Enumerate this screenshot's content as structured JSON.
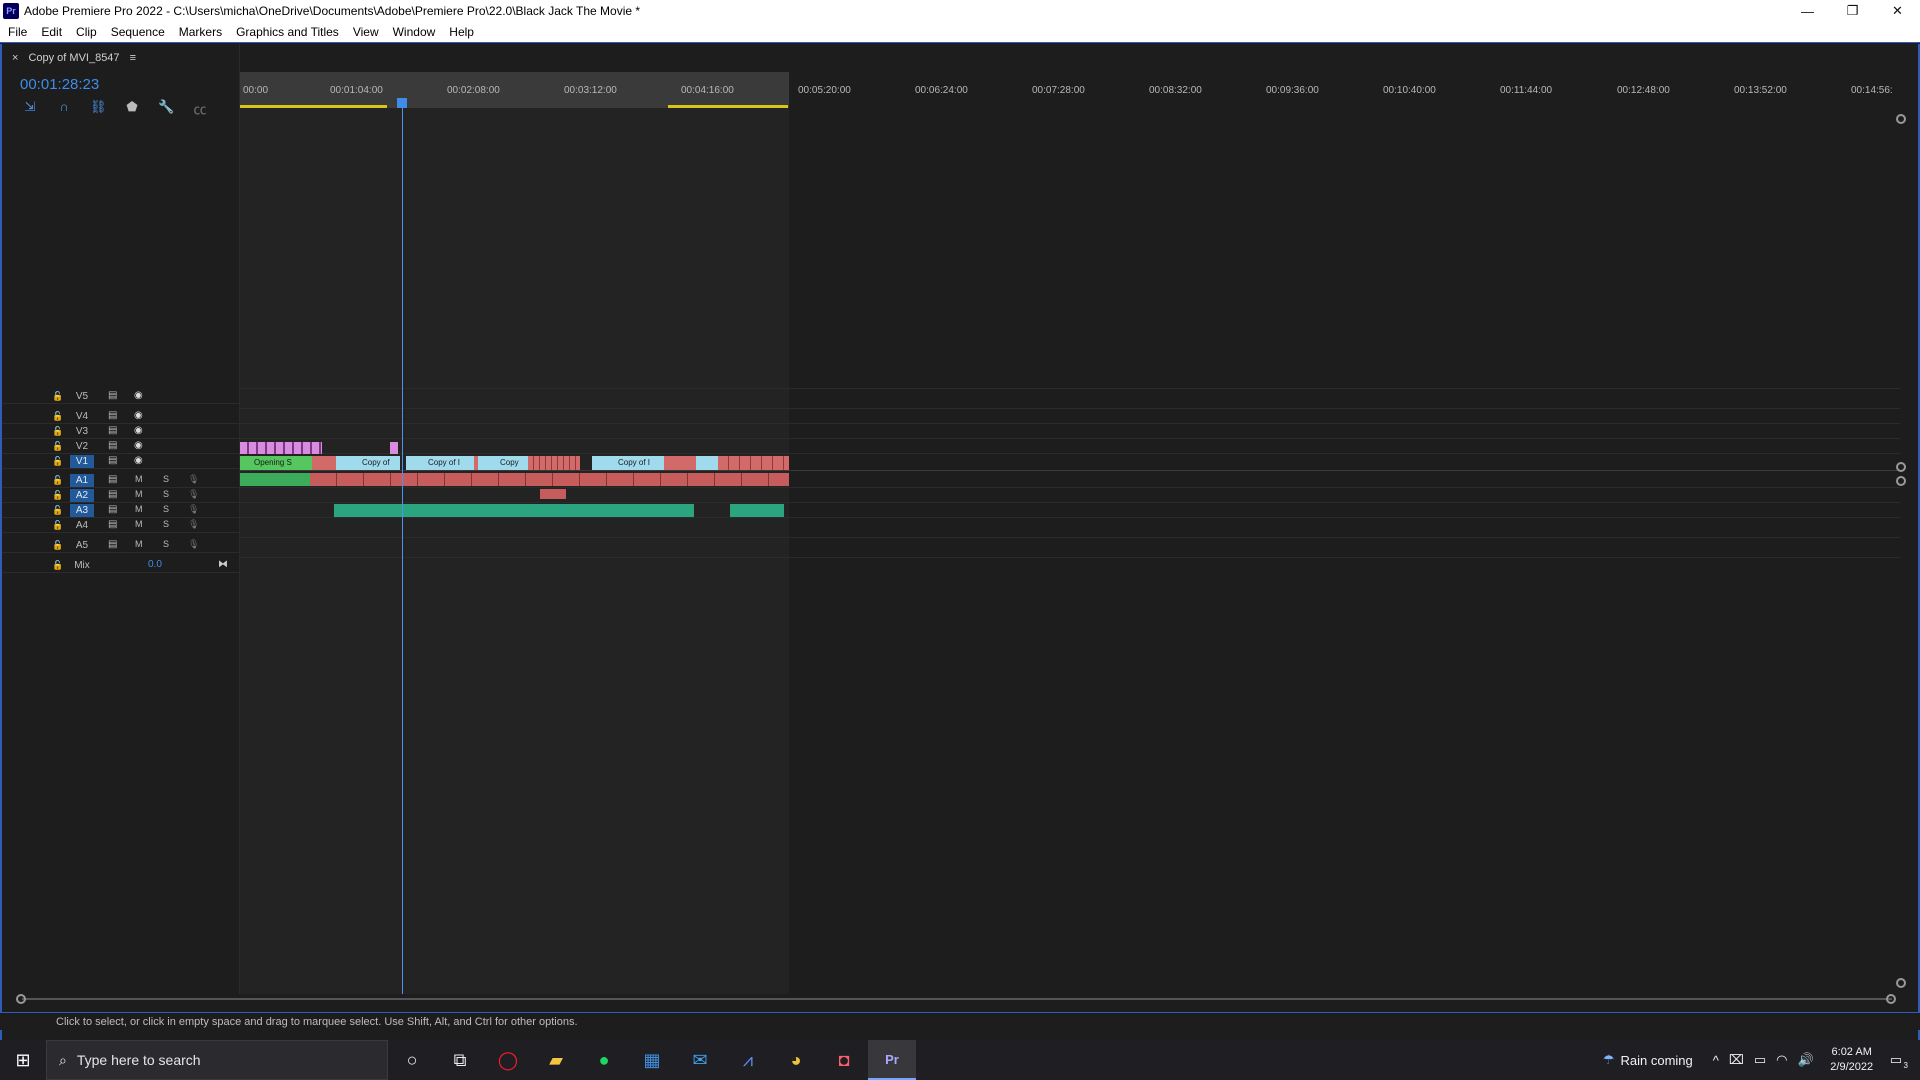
{
  "window": {
    "title": "Adobe Premiere Pro 2022 - C:\\Users\\micha\\OneDrive\\Documents\\Adobe\\Premiere Pro\\22.0\\Black Jack The Movie *",
    "app_badge": "Pr",
    "minimize": "—",
    "restore": "❐",
    "close": "✕"
  },
  "menu": [
    "File",
    "Edit",
    "Clip",
    "Sequence",
    "Markers",
    "Graphics and Titles",
    "View",
    "Window",
    "Help"
  ],
  "panel": {
    "close_icon": "×",
    "tab_label": "Copy of MVI_8547",
    "menu_icon": "≡",
    "timecode": "00:01:28:23"
  },
  "tools": [
    "nest-icon",
    "snap-icon",
    "linked-selection-icon",
    "marker-icon",
    "wrench-icon",
    "captions-icon"
  ],
  "ruler": {
    "labels": [
      "00:00",
      "00:01:04:00",
      "00:02:08:00",
      "00:03:12:00",
      "00:04:16:00",
      "00:05:20:00",
      "00:06:24:00",
      "00:07:28:00",
      "00:08:32:00",
      "00:09:36:00",
      "00:10:40:00",
      "00:11:44:00",
      "00:12:48:00",
      "00:13:52:00",
      "00:14:56:"
    ]
  },
  "tracks": {
    "video": [
      "V5",
      "V4",
      "V3",
      "V2",
      "V1"
    ],
    "audio": [
      "A1",
      "A2",
      "A3",
      "A4",
      "A5"
    ],
    "mute": "M",
    "solo": "S",
    "mix_label": "Mix",
    "mix_value": "0.0"
  },
  "clips": {
    "v1": [
      "Opening S",
      "Copy of",
      "Copy of I",
      "Copy",
      "Copy of I"
    ]
  },
  "status": {
    "text": "Click to select, or click in empty space and drag to marquee select. Use Shift, Alt, and Ctrl for other options."
  },
  "taskbar": {
    "search_placeholder": "Type here to search",
    "weather": "Rain coming",
    "time": "6:02 AM",
    "date": "2/9/2022",
    "notification_count": "3"
  }
}
